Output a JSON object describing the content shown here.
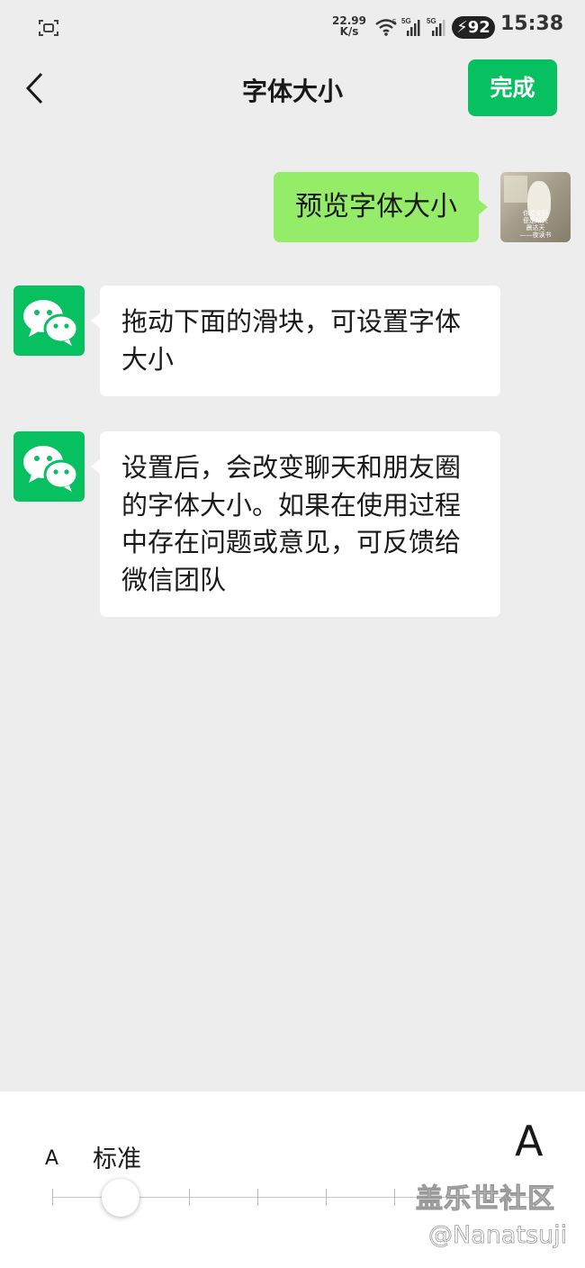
{
  "status_bar": {
    "net_speed": "22.99",
    "net_unit": "K/s",
    "wifi_badge": "5",
    "sig1_label": "5G",
    "sig2_label": "5G",
    "battery": "92",
    "time": "15:38"
  },
  "header": {
    "title": "字体大小",
    "done_label": "完成",
    "back_icon": "chevron-left-icon"
  },
  "chat": {
    "self_message": "预览字体大小",
    "self_avatar_caption": [
      "你若安好",
      "便是晴天",
      "晨达天",
      "——夜读书"
    ],
    "bot_messages": [
      "拖动下面的滑块，可设置字体大小",
      "设置后，会改变聊天和朋友圈的字体大小。如果在使用过程中存在问题或意见，可反馈给微信团队"
    ]
  },
  "font_slider": {
    "small_label": "A",
    "current_label": "标准",
    "large_label": "A",
    "level_index": 1,
    "level_count": 8
  },
  "watermark": {
    "site": "盖乐世社区",
    "user": "@Nanatsuji"
  },
  "colors": {
    "accent_green": "#07c160",
    "self_bubble": "#95ec69",
    "background": "#ededed"
  }
}
